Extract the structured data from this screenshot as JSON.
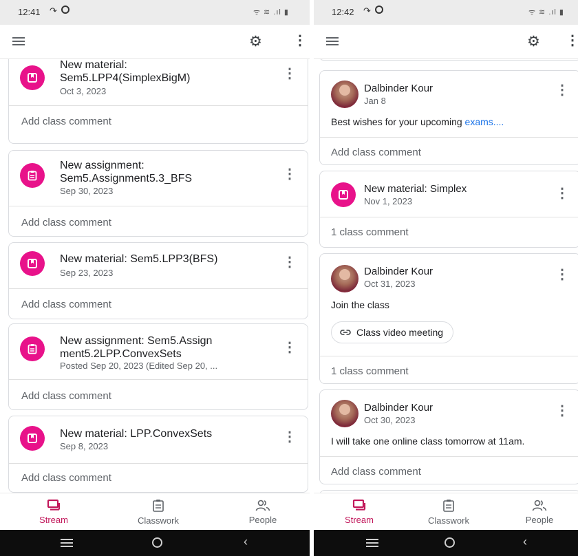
{
  "left": {
    "status_time": "12:41",
    "status_right": "ᯤ ≋ .ıl ▮",
    "posts": [
      {
        "type": "material",
        "title_line1": "New material:",
        "title_line2": "Sem5.LPP4(SimplexBigM)",
        "date": "Oct 3, 2023",
        "comment": "Add class comment"
      },
      {
        "type": "assignment",
        "title_line1": "New assignment:",
        "title_line2": "Sem5.Assignment5.3_BFS",
        "date": "Sep 30, 2023",
        "comment": "Add class comment"
      },
      {
        "type": "material",
        "title_line1": "New material: Sem5.LPP3(BFS)",
        "date": "Sep 23, 2023",
        "comment": "Add class comment"
      },
      {
        "type": "assignment",
        "title_line1": "New assignment: Sem5.Assign",
        "title_line2": "ment5.2LPP.ConvexSets",
        "date": "Posted Sep 20, 2023 (Edited Sep 20, ...",
        "comment": "Add class comment"
      },
      {
        "type": "material",
        "title_line1": "New material: LPP.ConvexSets",
        "date": "Sep 8, 2023",
        "comment": "Add class comment"
      }
    ]
  },
  "right": {
    "status_time": "12:42",
    "status_right": "ᯤ ≋ .ıl ▮",
    "posts": [
      {
        "author": "Dalbinder Kour",
        "date": "Jan 8",
        "body_text": "Best wishes for your upcoming ",
        "body_link": "exams....",
        "comment": "Add class comment"
      },
      {
        "title": "New material: Simplex",
        "date": "Nov 1, 2023",
        "comment": "1 class comment"
      },
      {
        "author": "Dalbinder Kour",
        "date": "Oct 31, 2023",
        "body": "Join the class",
        "chip": "Class video meeting",
        "comment": "1 class comment"
      },
      {
        "author": "Dalbinder Kour",
        "date": "Oct 30, 2023",
        "body": "I will take one online class tomorrow at 11am.",
        "comment": "Add class comment"
      }
    ]
  },
  "nav": {
    "stream": "Stream",
    "classwork": "Classwork",
    "people": "People"
  },
  "icons": {
    "settings": "gear-icon",
    "menu": "hamburger-icon",
    "more": "more-vert-icon",
    "material": "bookmark-icon",
    "assignment": "assignment-icon",
    "link": "link-icon"
  },
  "colors": {
    "accent": "#e8128a",
    "active_tab": "#c2185b",
    "link": "#1a73e8"
  }
}
